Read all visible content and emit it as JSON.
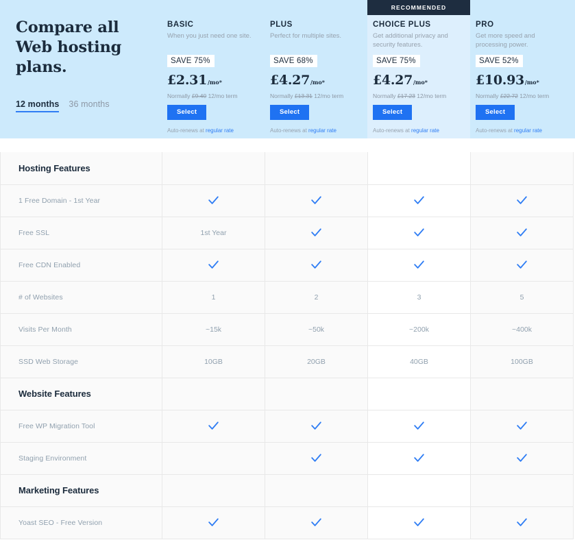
{
  "hero": {
    "title": "Compare all Web hosting plans.",
    "terms": [
      {
        "label": "12 months",
        "active": true
      },
      {
        "label": "36 months",
        "active": false
      }
    ],
    "recommended_badge": "RECOMMENDED",
    "accent_color": "#1f72f2",
    "hero_bg": "#cdeafc",
    "recommended_bg": "#ddeffd",
    "banner_bg": "#1e2d40",
    "plans": [
      {
        "name": "BASIC",
        "tagline": "When you just need one site.",
        "save": "SAVE 75%",
        "price": "£2.31",
        "price_suffix": "/mo*",
        "normally_prefix": "Normally",
        "normally_price": "£9.40",
        "normally_term": "12/mo term",
        "select_label": "Select",
        "autorenew_prefix": "Auto-renews at",
        "autorenew_link": "regular rate",
        "recommended": false
      },
      {
        "name": "PLUS",
        "tagline": "Perfect for multiple sites.",
        "save": "SAVE 68%",
        "price": "£4.27",
        "price_suffix": "/mo*",
        "normally_prefix": "Normally",
        "normally_price": "£13.31",
        "normally_term": "12/mo term",
        "select_label": "Select",
        "autorenew_prefix": "Auto-renews at",
        "autorenew_link": "regular rate",
        "recommended": false
      },
      {
        "name": "CHOICE PLUS",
        "tagline": "Get additional privacy and security features.",
        "save": "SAVE 75%",
        "price": "£4.27",
        "price_suffix": "/mo*",
        "normally_prefix": "Normally",
        "normally_price": "£17.23",
        "normally_term": "12/mo term",
        "select_label": "Select",
        "autorenew_prefix": "Auto-renews at",
        "autorenew_link": "regular rate",
        "recommended": true
      },
      {
        "name": "PRO",
        "tagline": "Get more speed and processing power.",
        "save": "SAVE 52%",
        "price": "£10.93",
        "price_suffix": "/mo*",
        "normally_prefix": "Normally",
        "normally_price": "£22.72",
        "normally_term": "12/mo term",
        "select_label": "Select",
        "autorenew_prefix": "Auto-renews at",
        "autorenew_link": "regular rate",
        "recommended": false
      }
    ]
  },
  "comparison": {
    "check_color": "#2f7df4",
    "rows": [
      {
        "type": "section",
        "label": "Hosting Features",
        "values": [
          "",
          "",
          "",
          ""
        ]
      },
      {
        "type": "feature",
        "label": "1 Free Domain - 1st Year",
        "values": [
          "check",
          "check",
          "check",
          "check"
        ]
      },
      {
        "type": "feature",
        "label": "Free SSL",
        "values": [
          "1st Year",
          "check",
          "check",
          "check"
        ]
      },
      {
        "type": "feature",
        "label": "Free CDN Enabled",
        "values": [
          "check",
          "check",
          "check",
          "check"
        ]
      },
      {
        "type": "feature",
        "label": "# of Websites",
        "values": [
          "1",
          "2",
          "3",
          "5"
        ]
      },
      {
        "type": "feature",
        "label": "Visits Per Month",
        "values": [
          "~15k",
          "~50k",
          "~200k",
          "~400k"
        ]
      },
      {
        "type": "feature",
        "label": "SSD Web Storage",
        "values": [
          "10GB",
          "20GB",
          "40GB",
          "100GB"
        ]
      },
      {
        "type": "section",
        "label": "Website Features",
        "values": [
          "",
          "",
          "",
          ""
        ]
      },
      {
        "type": "feature",
        "label": "Free WP Migration Tool",
        "values": [
          "check",
          "check",
          "check",
          "check"
        ]
      },
      {
        "type": "feature",
        "label": "Staging Environment",
        "values": [
          "",
          "check",
          "check",
          "check"
        ]
      },
      {
        "type": "section",
        "label": "Marketing Features",
        "values": [
          "",
          "",
          "",
          ""
        ]
      },
      {
        "type": "feature",
        "label": "Yoast SEO - Free Version",
        "values": [
          "check",
          "check",
          "check",
          "check"
        ]
      }
    ]
  }
}
